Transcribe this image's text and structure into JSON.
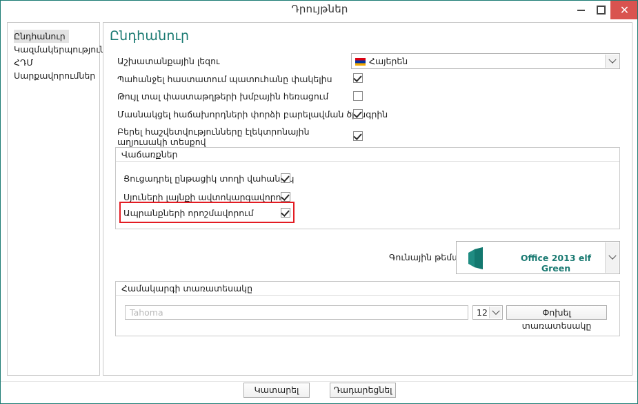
{
  "window": {
    "title": "Դրույթներ",
    "minimize_label": "–",
    "maximize_label": "□",
    "close_label": "✕"
  },
  "sidebar": {
    "items": [
      {
        "label": "Ընդհանուր",
        "selected": true
      },
      {
        "label": "Կազմակերպություն",
        "selected": false
      },
      {
        "label": "ՀԴՄ",
        "selected": false
      },
      {
        "label": "Սարքավորումներ",
        "selected": false
      }
    ]
  },
  "main": {
    "page_title": "Ընդհանուր",
    "language_row": {
      "label": "Աշխատանքային լեզու",
      "value": "Հայերեն",
      "flag": "armenia-flag-icon"
    },
    "options": [
      {
        "label": "Պահանջել հաստատում պատուհանը փակելիս",
        "checked": true
      },
      {
        "label": "Թույլ տալ փաստաթղթերի խմբային հեռացում",
        "checked": false
      },
      {
        "label": "Մասնակցել հաճախորդների փորձի բարելավման ծրագրին",
        "checked": true
      },
      {
        "label": "Բերել հաշվետվությունները էլեկտրոնային աղյուսակի տեսքով",
        "checked": true
      }
    ],
    "sales_group": {
      "caption": "Վաճառքներ",
      "options": [
        {
          "label": "Ցուցադրել ընթացիկ տողի վահանակ",
          "checked": true,
          "highlighted": false
        },
        {
          "label": "Սյուների լայնքի ավտոկարգավորում",
          "checked": true,
          "highlighted": false
        },
        {
          "label": "Ապրանքների որոշմավորում",
          "checked": true,
          "highlighted": true
        }
      ]
    },
    "theme": {
      "label": "Գունային թեմա",
      "value": "Office 2013 elf Green",
      "icon": "office-logo-icon",
      "accent_color": "#1a7a72"
    },
    "font_group": {
      "caption": "Համակարգի տառատեսակը",
      "font_placeholder": "Tahoma",
      "font_value": "",
      "size_value": "12",
      "change_button": "Փոխել տառատեսակը"
    }
  },
  "footer": {
    "ok_label": "Կատարել",
    "cancel_label": "Դադարեցնել"
  }
}
